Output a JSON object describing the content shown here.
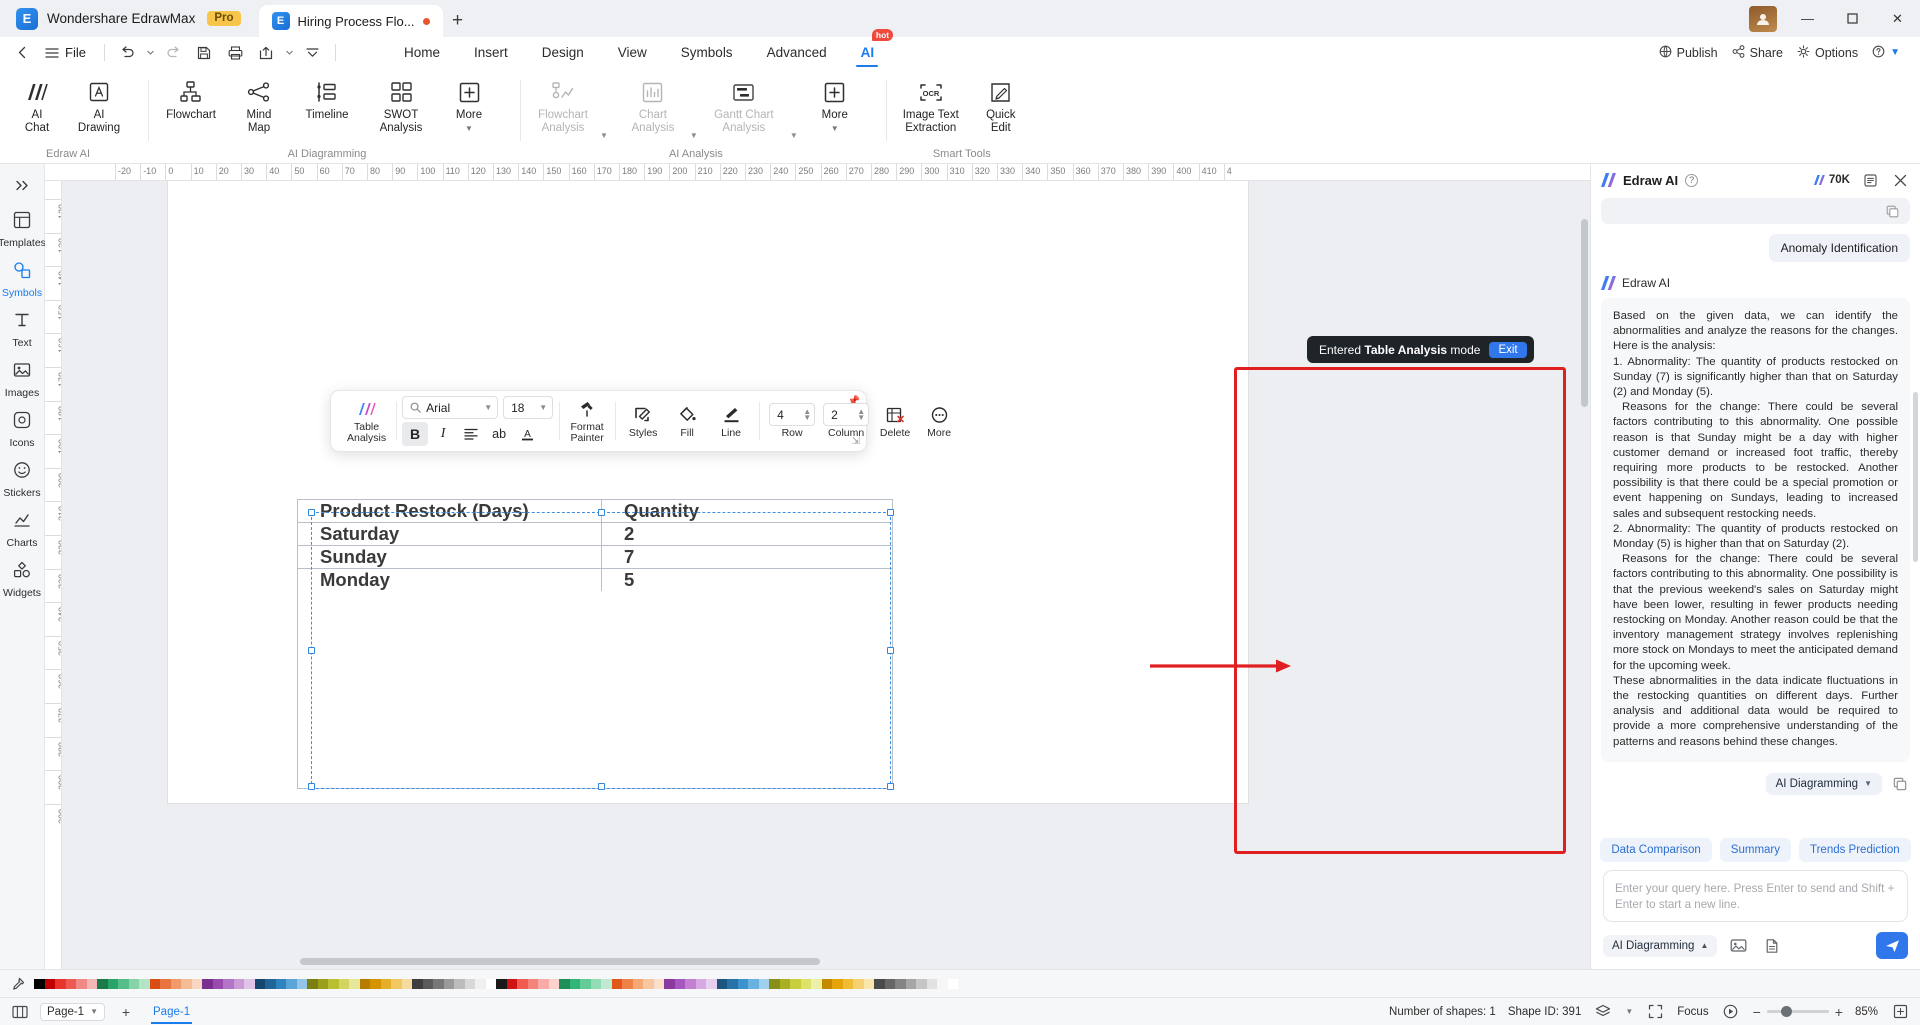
{
  "titlebar": {
    "brand": "Wondershare EdrawMax",
    "pro_badge": "Pro",
    "doc_tab": "Hiring Process Flo...",
    "new_tab": "+",
    "minimize": "—",
    "maximize": "❐",
    "close": "✕"
  },
  "menubar": {
    "file": "File",
    "tabs": [
      {
        "label": "Home",
        "active": false
      },
      {
        "label": "Insert",
        "active": false
      },
      {
        "label": "Design",
        "active": false
      },
      {
        "label": "View",
        "active": false
      },
      {
        "label": "Symbols",
        "active": false
      },
      {
        "label": "Advanced",
        "active": false
      },
      {
        "label": "AI",
        "active": true,
        "badge": "hot"
      }
    ],
    "right": {
      "publish": "Publish",
      "share": "Share",
      "options": "Options"
    }
  },
  "ribbon": {
    "groups": [
      {
        "label": "Edraw AI",
        "items": [
          {
            "name": "ai-chat",
            "label": "AI\nChat",
            "disabled": false
          },
          {
            "name": "ai-drawing",
            "label": "AI\nDrawing",
            "disabled": false
          }
        ]
      },
      {
        "label": "AI Diagramming",
        "items": [
          {
            "name": "flowchart",
            "label": "Flowchart",
            "disabled": false
          },
          {
            "name": "mind-map",
            "label": "Mind\nMap",
            "disabled": false
          },
          {
            "name": "timeline",
            "label": "Timeline",
            "disabled": false
          },
          {
            "name": "swot-analysis",
            "label": "SWOT\nAnalysis",
            "disabled": false
          },
          {
            "name": "more-diagramming",
            "label": "More",
            "disabled": false,
            "caret": true
          }
        ]
      },
      {
        "label": "AI Analysis",
        "items": [
          {
            "name": "flowchart-analysis",
            "label": "Flowchart\nAnalysis",
            "disabled": true,
            "caret_inline": true
          },
          {
            "name": "chart-analysis",
            "label": "Chart\nAnalysis",
            "disabled": true,
            "caret_inline": true
          },
          {
            "name": "gantt-chart-analysis",
            "label": "Gantt Chart\nAnalysis",
            "disabled": true,
            "caret_inline": true
          },
          {
            "name": "more-analysis",
            "label": "More",
            "disabled": false,
            "caret": true
          }
        ]
      },
      {
        "label": "Smart Tools",
        "items": [
          {
            "name": "image-text-extraction",
            "label": "Image Text\nExtraction",
            "disabled": false
          },
          {
            "name": "quick-edit",
            "label": "Quick\nEdit",
            "disabled": false
          }
        ]
      }
    ]
  },
  "rail": {
    "items": [
      {
        "name": "templates",
        "label": "Templates",
        "active": false
      },
      {
        "name": "symbols",
        "label": "Symbols",
        "active": true
      },
      {
        "name": "text",
        "label": "Text",
        "active": false
      },
      {
        "name": "images",
        "label": "Images",
        "active": false
      },
      {
        "name": "icons",
        "label": "Icons",
        "active": false
      },
      {
        "name": "stickers",
        "label": "Stickers",
        "active": false
      },
      {
        "name": "charts",
        "label": "Charts",
        "active": false
      },
      {
        "name": "widgets",
        "label": "Widgets",
        "active": false
      }
    ]
  },
  "rulers": {
    "horizontal": [
      "-20",
      "-10",
      "0",
      "10",
      "20",
      "30",
      "40",
      "50",
      "60",
      "70",
      "80",
      "90",
      "100",
      "110",
      "120",
      "130",
      "140",
      "150",
      "160",
      "170",
      "180",
      "190",
      "200",
      "210",
      "220",
      "230",
      "240",
      "250",
      "260",
      "270",
      "280",
      "290",
      "300",
      "310",
      "320",
      "330",
      "340",
      "350",
      "360",
      "370",
      "380",
      "390",
      "400",
      "410",
      "4"
    ],
    "vertical": [
      "120",
      "130",
      "140",
      "150",
      "160",
      "170",
      "180",
      "190",
      "200",
      "210",
      "220",
      "230",
      "240",
      "250",
      "260",
      "270",
      "280",
      "290",
      "300"
    ]
  },
  "floating_toolbar": {
    "table_analysis": "Table\nAnalysis",
    "font_family": "Arial",
    "font_size": "18",
    "bold": "B",
    "italic": "I",
    "align": "align-icon",
    "text_case": "ab",
    "font_color": "A",
    "format_painter": "Format\nPainter",
    "styles": "Styles",
    "fill": "Fill",
    "line": "Line",
    "row_value": "4",
    "row_label": "Row",
    "column_value": "2",
    "column_label": "Column",
    "delete": "Delete",
    "more": "More"
  },
  "table": {
    "headers": [
      "Product Restock (Days)",
      "Quantity"
    ],
    "rows": [
      [
        "Saturday",
        "2"
      ],
      [
        "Sunday",
        "7"
      ],
      [
        "Monday",
        "5"
      ]
    ]
  },
  "toast": {
    "prefix": "Entered ",
    "mode": "Table Analysis",
    "suffix": " mode",
    "exit": "Exit"
  },
  "ai_panel": {
    "title": "Edraw AI",
    "tokens": "70K",
    "user_chip": "Anomaly Identification",
    "assistant_name": "Edraw AI",
    "response": [
      "Based on the given data, we can identify the abnormalities and analyze the reasons for the changes. Here is the analysis:",
      "1. Abnormality: The quantity of products restocked on Sunday (7) is significantly higher than that on Saturday (2) and Monday (5).",
      "Reasons for the change: There could be several factors contributing to this abnormality. One possible reason is that Sunday might be a day with higher customer demand or increased foot traffic, thereby requiring more products to be restocked. Another possibility is that there could be a special promotion or event happening on Sundays, leading to increased sales and subsequent restocking needs.",
      "2. Abnormality: The quantity of products restocked on Monday (5) is higher than that on Saturday (2).",
      "Reasons for the change: There could be several factors contributing to this abnormality. One possibility is that the previous weekend's sales on Saturday might have been lower, resulting in fewer products needing restocking on Monday. Another reason could be that the inventory management strategy involves replenishing more stock on Mondays to meet the anticipated demand for the upcoming week.",
      "These abnormalities in the data indicate fluctuations in the restocking quantities on different days. Further analysis and additional data would be required to provide a more comprehensive understanding of the patterns and reasons behind these changes."
    ],
    "response_mode": "AI Diagramming",
    "suggestions": [
      "Data Comparison",
      "Summary",
      "Trends Prediction"
    ],
    "composer_placeholder": "Enter your query here. Press Enter to send and Shift + Enter to start a new line.",
    "composer_mode": "AI Diagramming"
  },
  "statusbar": {
    "page_tab": "Page-1",
    "page_active": "Page-1",
    "shapes": "Number of shapes: 1",
    "shape_id": "Shape ID: 391",
    "focus": "Focus",
    "zoom": "85%"
  },
  "colors": {
    "accent": "#1b7ced",
    "annotation": "#e02020",
    "toast_bg": "#1f2429",
    "send": "#2f77ea"
  },
  "palette": {
    "row1": [
      "#000000",
      "#c00000",
      "#e8352b",
      "#ec5a52",
      "#f08a86",
      "#f4b6b3",
      "#1a7a4a",
      "#2aa36a",
      "#55bd88",
      "#86d2a9",
      "#b5e3c8",
      "#d94c14",
      "#e7753d",
      "#ef9a6a",
      "#f4bb96",
      "#f8d6c0",
      "#7a2f8f",
      "#9a4bb0",
      "#b473c6",
      "#cb9cd8",
      "#e0c4e8",
      "#16486e",
      "#1f6596",
      "#2f84bd",
      "#5aa5d6",
      "#93c6e6",
      "#7a7f12",
      "#9aa01c",
      "#b9bf33",
      "#d2d661",
      "#e5e89a",
      "#b57c00",
      "#d49400",
      "#e6ae28",
      "#efc763",
      "#f5dc9e",
      "#3e3e3e",
      "#5a5a5a",
      "#787878",
      "#9a9a9a",
      "#bcbcbc",
      "#d8d8d8",
      "#efefef",
      "#ffffff"
    ],
    "row2": [
      "#1a1a1a",
      "#d01212",
      "#f05a4f",
      "#f58379",
      "#f9aca5",
      "#fcd2ce",
      "#1f8f57",
      "#33b478",
      "#62cb96",
      "#93dcb6",
      "#c0e9d3",
      "#e1571b",
      "#ef8248",
      "#f5a776",
      "#f8c6a3",
      "#fbdfcb",
      "#8a3a9e",
      "#a857bf",
      "#c280d3",
      "#d7a8e2",
      "#e9cfee",
      "#1c567f",
      "#2674a7",
      "#3a93cc",
      "#68b2e0",
      "#a0d0ec",
      "#8a8f18",
      "#a9b024",
      "#c8ce3c",
      "#dde06b",
      "#eef0a6",
      "#c68a00",
      "#e3a40c",
      "#f0bb35",
      "#f6d174",
      "#fae5ab",
      "#4a4a4a",
      "#666666",
      "#848484",
      "#a6a6a6",
      "#c6c6c6",
      "#e2e2e2",
      "#f6f6f6",
      "#ffffff"
    ]
  }
}
